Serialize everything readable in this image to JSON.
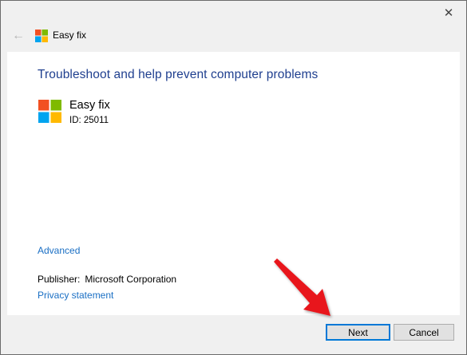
{
  "window": {
    "title": "Easy fix",
    "close_glyph": "✕",
    "back_glyph": "←"
  },
  "content": {
    "heading": "Troubleshoot and help prevent computer problems",
    "app_name": "Easy fix",
    "app_id": "ID: 25011",
    "advanced_link": "Advanced",
    "publisher_label": "Publisher:",
    "publisher_value": "Microsoft Corporation",
    "privacy_link": "Privacy statement"
  },
  "footer": {
    "next_label": "Next",
    "cancel_label": "Cancel"
  },
  "colors": {
    "heading": "#1f3f8f",
    "link": "#1a6fc4",
    "logo_red": "#f25022",
    "logo_green": "#7fba00",
    "logo_blue": "#00a4ef",
    "logo_yellow": "#ffb900",
    "annotation_arrow": "#e8151b"
  },
  "icons": {
    "close": "close-icon",
    "back": "back-arrow-icon",
    "logo": "microsoft-logo-icon",
    "annotation": "red-arrow-annotation"
  }
}
